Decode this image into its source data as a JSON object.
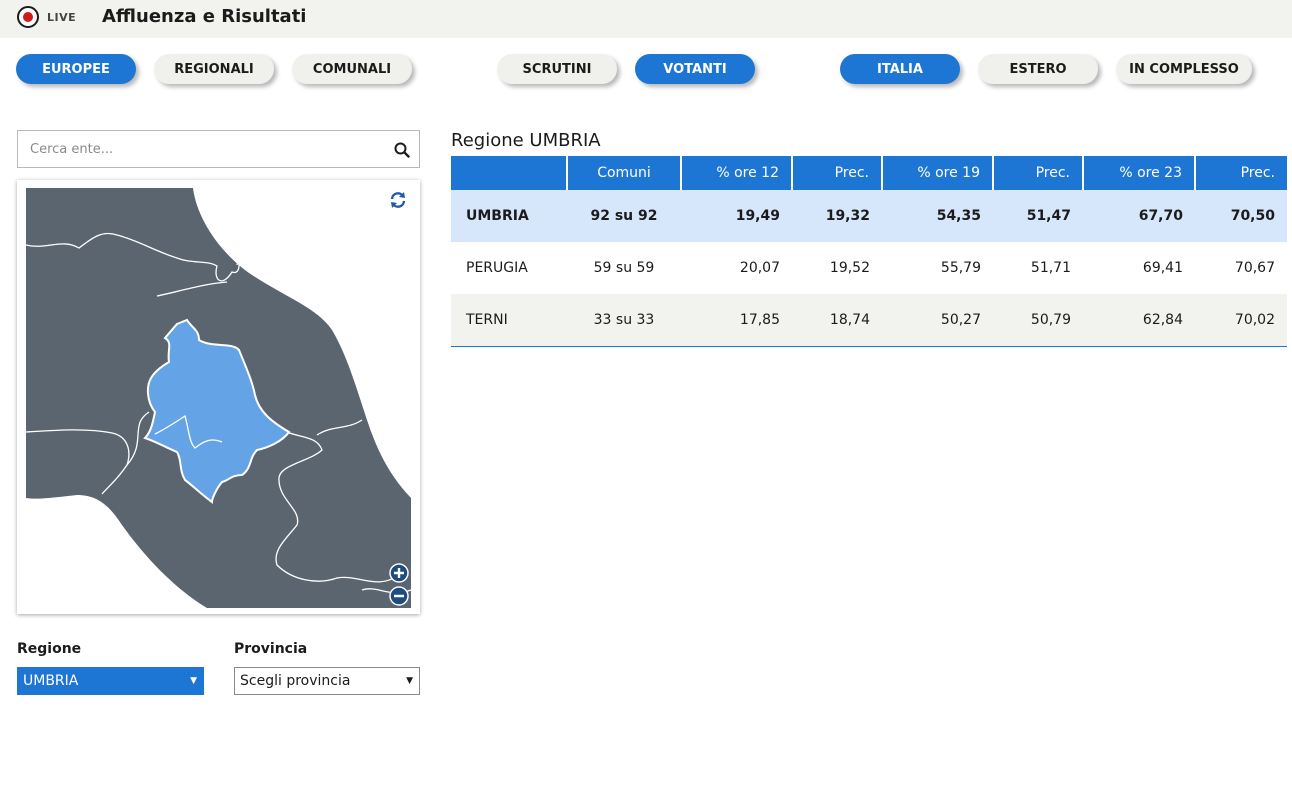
{
  "header": {
    "live_label": "LIVE",
    "title": "Affluenza e Risultati"
  },
  "tabs": [
    {
      "label": "EUROPEE",
      "active": true
    },
    {
      "label": "REGIONALI",
      "active": false
    },
    {
      "label": "COMUNALI",
      "active": false
    },
    {
      "label": "SCRUTINI",
      "active": false
    },
    {
      "label": "VOTANTI",
      "active": true
    },
    {
      "label": "ITALIA",
      "active": true
    },
    {
      "label": "ESTERO",
      "active": false
    },
    {
      "label": "IN COMPLESSO",
      "active": false
    }
  ],
  "search": {
    "placeholder": "Cerca ente...",
    "value": ""
  },
  "filters": {
    "regione_label": "Regione",
    "regione_value": "UMBRIA",
    "provincia_label": "Provincia",
    "provincia_value": "Scegli provincia"
  },
  "colors": {
    "accent": "#1e76d4",
    "selected_row": "#d6e7fb",
    "map_land": "#5a6570",
    "map_selected": "#64a4e6"
  },
  "table": {
    "title": "Regione UMBRIA",
    "headers": [
      "",
      "Comuni",
      "% ore 12",
      "Prec.",
      "% ore 19",
      "Prec.",
      "% ore 23",
      "Prec."
    ],
    "rows": [
      [
        "UMBRIA",
        "92 su 92",
        "19,49",
        "19,32",
        "54,35",
        "51,47",
        "67,70",
        "70,50"
      ],
      [
        "PERUGIA",
        "59 su 59",
        "20,07",
        "19,52",
        "55,79",
        "51,71",
        "69,41",
        "70,67"
      ],
      [
        "TERNI",
        "33 su 33",
        "17,85",
        "18,74",
        "50,27",
        "50,79",
        "62,84",
        "70,02"
      ]
    ]
  }
}
